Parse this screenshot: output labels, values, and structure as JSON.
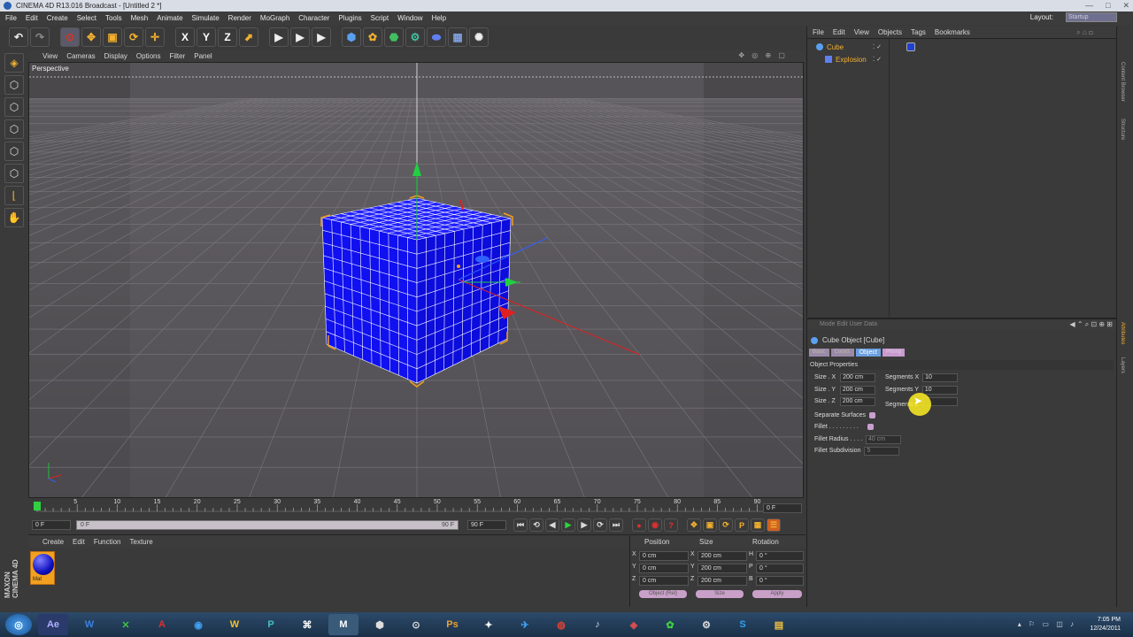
{
  "window": {
    "title": "CINEMA 4D R13.016 Broadcast - [Untitled 2 *]",
    "controls": [
      "—",
      "□",
      "✕"
    ]
  },
  "menubar": {
    "items": [
      "File",
      "Edit",
      "Create",
      "Select",
      "Tools",
      "Mesh",
      "Animate",
      "Simulate",
      "Render",
      "MoGraph",
      "Character",
      "Plugins",
      "Script",
      "Window",
      "Help"
    ],
    "layout_label": "Layout:",
    "layout_value": "Startup"
  },
  "toolbar": {
    "undo": "↶",
    "redo": "↷",
    "tools": [
      "⊙",
      "✥",
      "▣",
      "⟳",
      "✛"
    ],
    "axes": [
      "X",
      "Y",
      "Z"
    ],
    "render": [
      "▶",
      "▶",
      "▶"
    ],
    "create": [
      "⬢",
      "✿",
      "⬣",
      "⚙",
      "⬬",
      "▦",
      "✺"
    ]
  },
  "viewport": {
    "menu": [
      "View",
      "Cameras",
      "Display",
      "Options",
      "Filter",
      "Panel"
    ],
    "label": "Perspective",
    "nav_icons": "✥ ◎ ⊕ ▢"
  },
  "timeline": {
    "ticks": [
      "0",
      "5",
      "10",
      "15",
      "20",
      "25",
      "30",
      "35",
      "40",
      "45",
      "50",
      "55",
      "60",
      "65",
      "70",
      "75",
      "80",
      "85",
      "90"
    ],
    "end_frame": "0 F"
  },
  "transport": {
    "start": "0 F",
    "current": "0 F",
    "range_end": "90 F",
    "end": "90 F"
  },
  "material_manager": {
    "menu": [
      "Create",
      "Edit",
      "Function",
      "Texture"
    ],
    "material_name": "Mat"
  },
  "coordinates": {
    "headers": [
      "Position",
      "Size",
      "Rotation"
    ],
    "rows": [
      {
        "axis": "X",
        "pos": "0 cm",
        "saxis": "X",
        "size": "200 cm",
        "raxis": "H",
        "rot": "0 °"
      },
      {
        "axis": "Y",
        "pos": "0 cm",
        "saxis": "Y",
        "size": "200 cm",
        "raxis": "P",
        "rot": "0 °"
      },
      {
        "axis": "Z",
        "pos": "0 cm",
        "saxis": "Z",
        "size": "200 cm",
        "raxis": "B",
        "rot": "0 °"
      }
    ],
    "object_mode": "Object (Rel)",
    "size_mode": "Size",
    "apply": "Apply"
  },
  "object_manager": {
    "menu": [
      "File",
      "Edit",
      "View",
      "Objects",
      "Tags",
      "Bookmarks"
    ],
    "objects": [
      {
        "name": "Cube"
      },
      {
        "name": "Explosion"
      }
    ]
  },
  "attributes": {
    "header": "Mode  Edit  User Data",
    "title": "Cube Object [Cube]",
    "tabs": [
      "Basic",
      "Coord.",
      "Object",
      "Phong"
    ],
    "section": "Object Properties",
    "size_x_label": "Size . X",
    "size_x": "200 cm",
    "size_y_label": "Size . Y",
    "size_y": "200 cm",
    "size_z_label": "Size . Z",
    "size_z": "200 cm",
    "seg_x_label": "Segments X",
    "seg_x": "10",
    "seg_y_label": "Segments Y",
    "seg_y": "10",
    "seg_z_label": "Segments Z",
    "seg_z": "",
    "sep_surfaces": "Separate Surfaces",
    "fillet": "Fillet . . . . . . . . .",
    "fillet_radius_label": "Fillet Radius . . . .",
    "fillet_radius": "40 cm",
    "fillet_sub_label": "Fillet Subdivision",
    "fillet_sub": "5"
  },
  "side_tabs": [
    "Content Browser",
    "Structure",
    "Attributes",
    "Layers"
  ],
  "taskbar": {
    "apps": [
      "◎",
      "Ae",
      "W",
      "✕",
      "A",
      "◉",
      "W",
      "P",
      "⌘",
      "M",
      "⬢",
      "⊙",
      "Ps",
      "✦",
      "✈",
      "◍",
      "♪",
      "◈",
      "✿",
      "⚙",
      "S",
      "▤"
    ],
    "time": "7:05 PM",
    "date": "12/24/2011"
  },
  "colors": {
    "accent": "#f2b030",
    "cube": "#1616ff",
    "grid": "#6a676c"
  }
}
